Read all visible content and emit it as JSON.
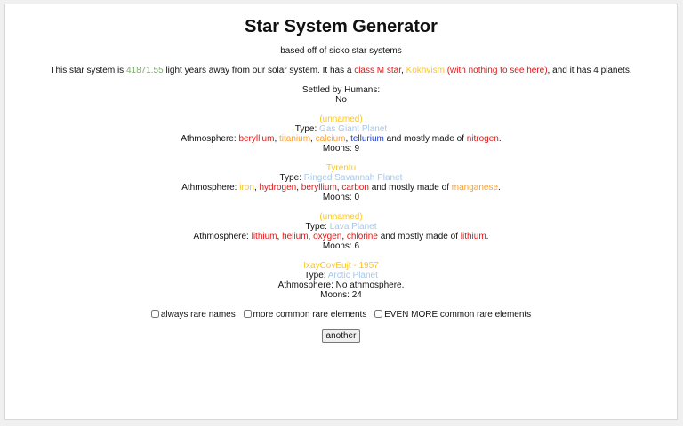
{
  "title": "Star System Generator",
  "subtitle": "based off of sicko star systems",
  "description": {
    "prefix": "This star system is ",
    "distance": "41871.55",
    "mid1": " light years away from our solar system. It has a ",
    "star_class": "class M star",
    "sep1": ", ",
    "star_name": "Kokhvism",
    "sep2": " ",
    "star_note": "(with nothing to see here)",
    "mid2": ", and it has ",
    "planet_count": "4",
    "suffix": " planets."
  },
  "settled": {
    "label": "Settled by Humans:",
    "value": "No"
  },
  "labels": {
    "type": "Type: ",
    "atmosphere": "Athmosphere: ",
    "mostly": " and mostly made of ",
    "moons": "Moons: ",
    "comma": ", ",
    "period": "."
  },
  "planets": [
    {
      "name": "(unnamed)",
      "type": "Gas Giant Planet",
      "elements": [
        {
          "name": "beryllium",
          "color": "#e01414"
        },
        {
          "name": "titanium",
          "color": "#ff9f2b"
        },
        {
          "name": "calcium",
          "color": "#ff9f2b"
        },
        {
          "name": "tellurium",
          "color": "#1f3bd6"
        }
      ],
      "main": {
        "name": "nitrogen",
        "color": "#e01414"
      },
      "moons": "9"
    },
    {
      "name": "Tyrentu",
      "type": "Ringed Savannah Planet",
      "elements": [
        {
          "name": "iron",
          "color": "#ffc51a"
        },
        {
          "name": "hydrogen",
          "color": "#e01414"
        },
        {
          "name": "beryllium",
          "color": "#e01414"
        },
        {
          "name": "carbon",
          "color": "#e01414"
        }
      ],
      "main": {
        "name": "manganese",
        "color": "#ff9f2b"
      },
      "moons": "0"
    },
    {
      "name": "(unnamed)",
      "type": "Lava Planet",
      "elements": [
        {
          "name": "lithium",
          "color": "#e01414"
        },
        {
          "name": "helium",
          "color": "#e01414"
        },
        {
          "name": "oxygen",
          "color": "#e01414"
        },
        {
          "name": "chlorine",
          "color": "#e01414"
        }
      ],
      "main": {
        "name": "lithium",
        "color": "#e01414"
      },
      "moons": "6"
    },
    {
      "name": "IxayCovEujt - 1957",
      "type": "Arctic Planet",
      "no_atmosphere": "No athmosphere.",
      "moons": "24"
    }
  ],
  "options": [
    {
      "label": "always rare names",
      "checked": false
    },
    {
      "label": "more common rare elements",
      "checked": false
    },
    {
      "label": "EVEN MORE common rare elements",
      "checked": false
    }
  ],
  "button_label": "another"
}
